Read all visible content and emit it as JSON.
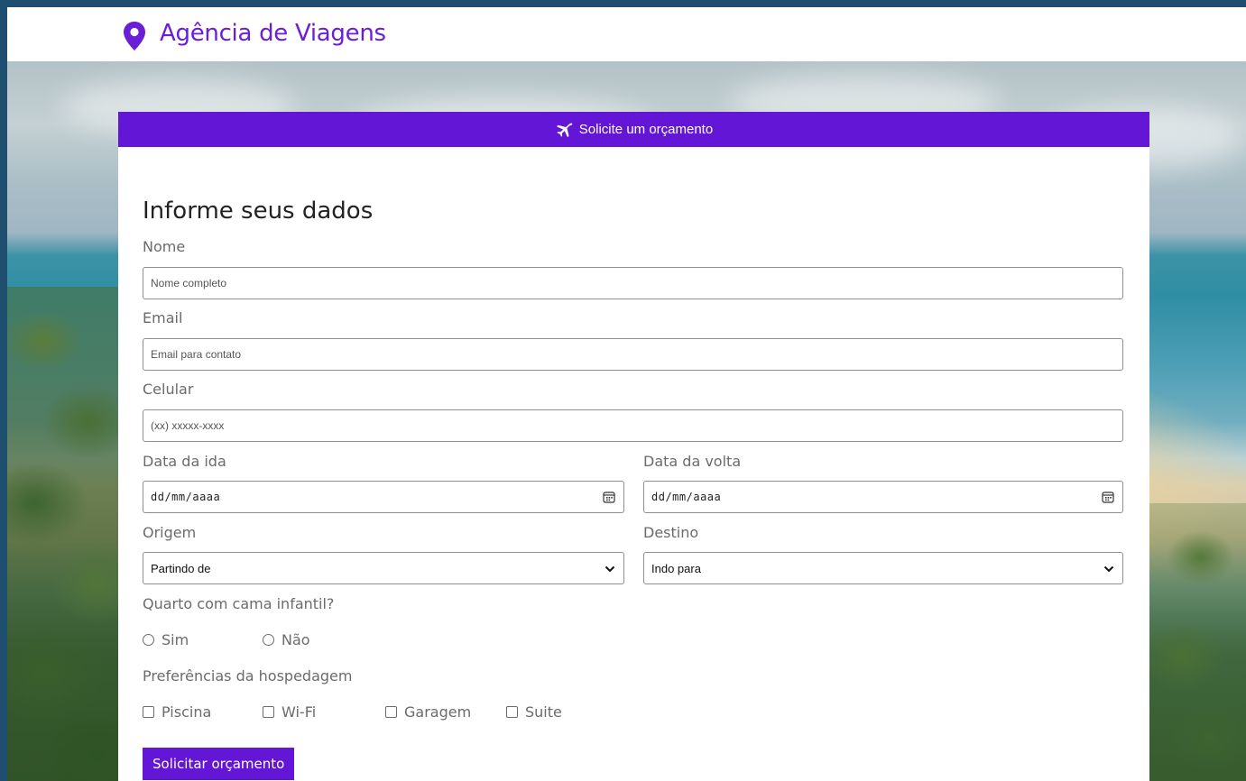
{
  "brand": {
    "name": "Agência de Viagens",
    "icon": "map-pin-icon"
  },
  "card": {
    "header": "Solicite um orçamento",
    "header_icon": "plane-icon"
  },
  "form": {
    "title": "Informe seus dados",
    "nome": {
      "label": "Nome",
      "placeholder": "Nome completo"
    },
    "email": {
      "label": "Email",
      "placeholder": "Email para contato"
    },
    "celular": {
      "label": "Celular",
      "placeholder": "(xx) xxxxx-xxxx"
    },
    "data_ida": {
      "label": "Data da ida",
      "value": "dd/mm/aaaa"
    },
    "data_volta": {
      "label": "Data da volta",
      "value": "dd/mm/aaaa"
    },
    "origem": {
      "label": "Origem",
      "selected": "Partindo de"
    },
    "destino": {
      "label": "Destino",
      "selected": "Indo para"
    },
    "cama_infantil": {
      "label": "Quarto com cama infantil?",
      "options": [
        "Sim",
        "Não"
      ]
    },
    "preferencias": {
      "label": "Preferências da hospedagem",
      "options": [
        "Piscina",
        "Wi-Fi",
        "Garagem",
        "Suite"
      ]
    },
    "submit_label": "Solicitar orçamento"
  },
  "colors": {
    "accent": "#6416d6",
    "brand_text": "#6a1ed6",
    "page_border": "#1f4f6e"
  }
}
